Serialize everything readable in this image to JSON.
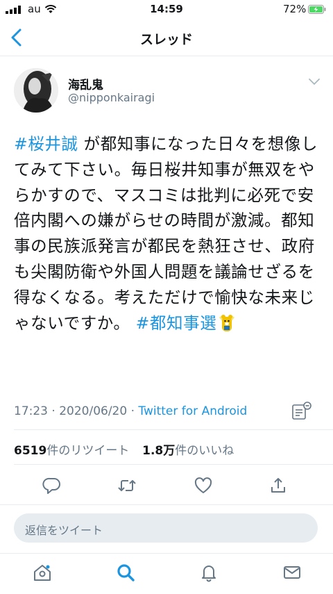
{
  "status_bar": {
    "carrier": "au",
    "time": "14:59",
    "battery": "72%"
  },
  "nav": {
    "title": "スレッド"
  },
  "tweet": {
    "name": "海乱鬼",
    "handle": "@nipponkairagi",
    "hashtag1": "#桜井誠",
    "text": " が都知事になった日々を想像してみて下さい。毎日桜井知事が無双をやらかすので、マスコミは批判に必死で安倍内閣への嫌がらせの時間が激減。都知事の民族派発言が都民を熱狂させ、政府も尖閣防衛や外国人問題を議論せざるを得なくなる。考えただけで愉快な未来じゃないですか。 ",
    "hashtag2": "#都知事選",
    "timestamp": "17:23 · 2020/06/20 · ",
    "source": "Twitter for Android"
  },
  "stats": {
    "retweets": "6519",
    "retweets_label": "件のリツイート",
    "likes": "1.8万",
    "likes_label": "件のいいね"
  },
  "reply": {
    "placeholder": "返信をツイート"
  },
  "colors": {
    "accent": "#1b95e0",
    "battery_green": "#4cd964",
    "secondary_text": "#657786",
    "divider": "#e6ecf0"
  },
  "icons": {
    "back": "chevron-left-icon",
    "caret": "chevron-down-icon",
    "analytics": "analytics-icon",
    "reply": "reply-icon",
    "retweet": "retweet-icon",
    "like": "heart-icon",
    "share": "share-icon",
    "home": "home-icon",
    "search": "search-icon",
    "notifications": "bell-icon",
    "messages": "mail-icon"
  }
}
